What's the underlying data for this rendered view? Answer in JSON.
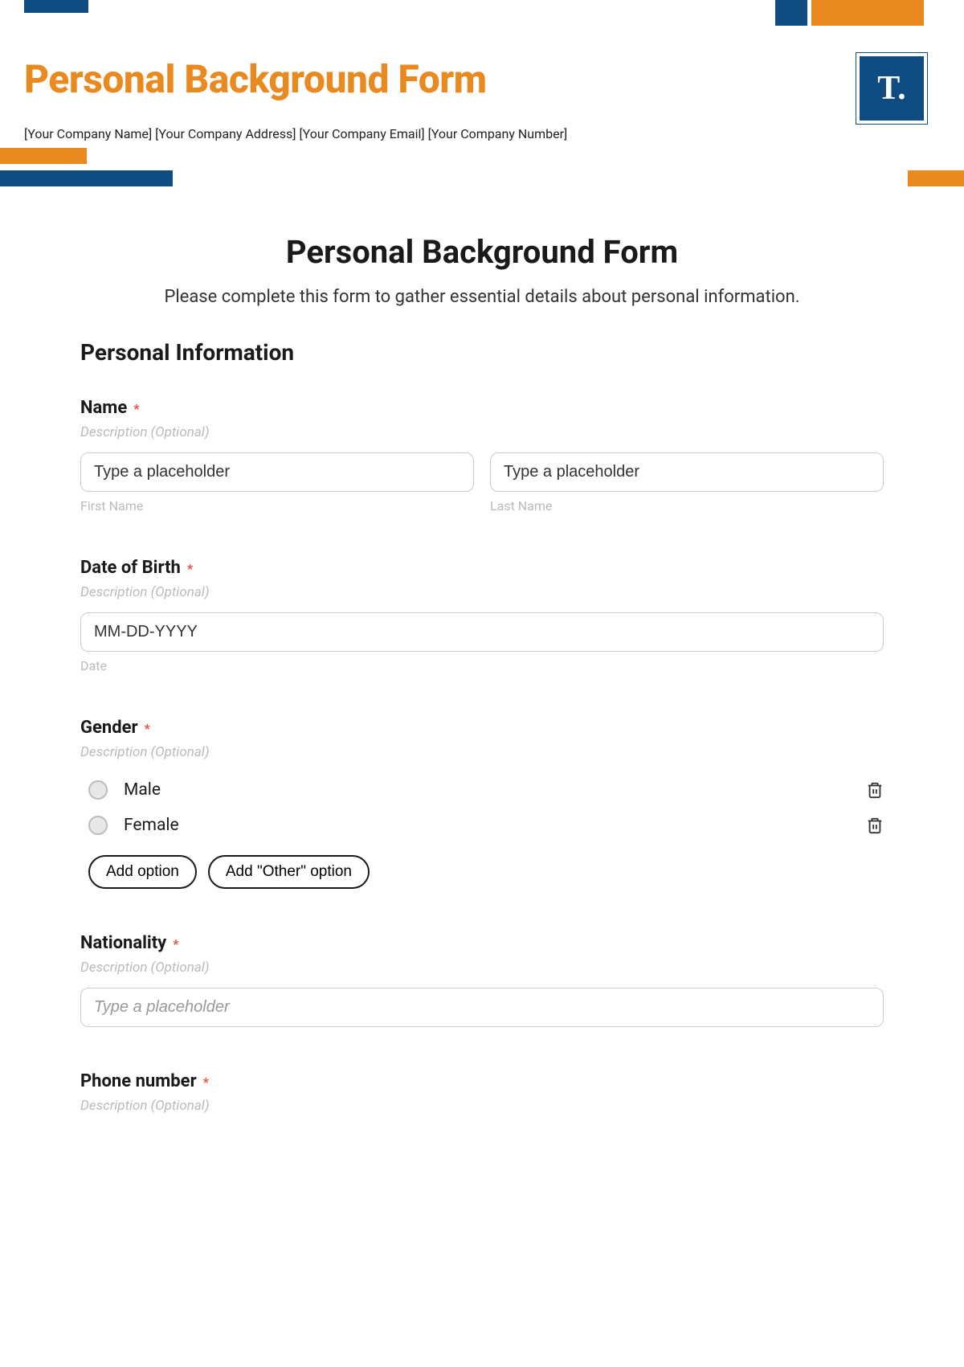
{
  "header": {
    "title": "Personal Background Form",
    "meta": "[Your Company Name] [Your Company Address] [Your Company Email] [Your Company Number]",
    "logo_text": "T."
  },
  "form": {
    "title": "Personal Background Form",
    "subtitle": "Please complete this form to gather essential details about personal information.",
    "section_title": "Personal Information"
  },
  "fields": {
    "name": {
      "label": "Name",
      "required_mark": "*",
      "desc": "Description (Optional)",
      "first_placeholder": "Type a placeholder",
      "last_placeholder": "Type a placeholder",
      "first_sublabel": "First Name",
      "last_sublabel": "Last Name"
    },
    "dob": {
      "label": "Date of Birth",
      "required_mark": "*",
      "desc": "Description (Optional)",
      "placeholder": "MM-DD-YYYY",
      "sublabel": "Date"
    },
    "gender": {
      "label": "Gender",
      "required_mark": "*",
      "desc": "Description (Optional)",
      "options": [
        {
          "label": "Male"
        },
        {
          "label": "Female"
        }
      ],
      "add_option": "Add option",
      "add_other": "Add \"Other\" option"
    },
    "nationality": {
      "label": "Nationality",
      "required_mark": "*",
      "desc": "Description (Optional)",
      "placeholder": "Type a placeholder"
    },
    "phone": {
      "label": "Phone number",
      "required_mark": "*",
      "desc": "Description (Optional)"
    }
  }
}
